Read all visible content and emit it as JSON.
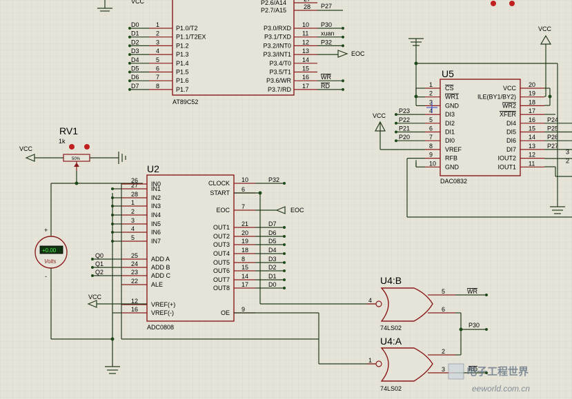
{
  "title": "",
  "components": {
    "at89c52": {
      "name": "AT89C52",
      "top_pins": [
        {
          "label": "P2.6/A14",
          "num": "27",
          "net": ""
        },
        {
          "label": "P2.7/A15",
          "num": "28",
          "net": "P27"
        }
      ],
      "left_pins": [
        {
          "net": "D0",
          "num": "1",
          "label": "P1.0/T2"
        },
        {
          "net": "D1",
          "num": "2",
          "label": "P1.1/T2EX"
        },
        {
          "net": "D2",
          "num": "3",
          "label": "P1.2"
        },
        {
          "net": "D3",
          "num": "4",
          "label": "P1.3"
        },
        {
          "net": "D4",
          "num": "5",
          "label": "P1.4"
        },
        {
          "net": "D5",
          "num": "6",
          "label": "P1.5"
        },
        {
          "net": "D6",
          "num": "7",
          "label": "P1.6"
        },
        {
          "net": "D7",
          "num": "8",
          "label": "P1.7"
        }
      ],
      "right_pins": [
        {
          "label": "P3.0/RXD",
          "num": "10",
          "net": "P30"
        },
        {
          "label": "P3.1/TXD",
          "num": "11",
          "net": "xuan"
        },
        {
          "label": "P3.2/INT0",
          "num": "12",
          "net": "P32"
        },
        {
          "label": "P3.3/INT1",
          "num": "13",
          "net": "EOC"
        },
        {
          "label": "P3.4/T0",
          "num": "14",
          "net": ""
        },
        {
          "label": "P3.5/T1",
          "num": "15",
          "net": ""
        },
        {
          "label": "P3.6/WR",
          "num": "16",
          "net": "WR"
        },
        {
          "label": "P3.7/RD",
          "num": "17",
          "net": "RD"
        }
      ]
    },
    "adc0808": {
      "ref": "U2",
      "name": "ADC0808",
      "left_pins": [
        {
          "net": "",
          "num": "26",
          "label": "IN0"
        },
        {
          "net": "",
          "num": "27",
          "label": "IN1"
        },
        {
          "net": "",
          "num": "28",
          "label": "IN2"
        },
        {
          "net": "",
          "num": "1",
          "label": "IN3"
        },
        {
          "net": "",
          "num": "2",
          "label": "IN4"
        },
        {
          "net": "",
          "num": "3",
          "label": "IN5"
        },
        {
          "net": "",
          "num": "4",
          "label": "IN6"
        },
        {
          "net": "",
          "num": "5",
          "label": "IN7"
        },
        {
          "net": "Q0",
          "num": "25",
          "label": "ADD A"
        },
        {
          "net": "Q1",
          "num": "24",
          "label": "ADD B"
        },
        {
          "net": "Q2",
          "num": "23",
          "label": "ADD C"
        },
        {
          "net": "",
          "num": "22",
          "label": "ALE"
        },
        {
          "net": "",
          "num": "12",
          "label": "VREF(+)"
        },
        {
          "net": "",
          "num": "16",
          "label": "VREF(-)"
        }
      ],
      "right_pins": [
        {
          "label": "CLOCK",
          "num": "10",
          "net": "P32"
        },
        {
          "label": "START",
          "num": "6",
          "net": ""
        },
        {
          "label": "EOC",
          "num": "7",
          "net": "EOC"
        },
        {
          "label": "OUT1",
          "num": "21",
          "net": "D7"
        },
        {
          "label": "OUT2",
          "num": "20",
          "net": "D6"
        },
        {
          "label": "OUT3",
          "num": "19",
          "net": "D5"
        },
        {
          "label": "OUT4",
          "num": "18",
          "net": "D4"
        },
        {
          "label": "OUT5",
          "num": "8",
          "net": "D3"
        },
        {
          "label": "OUT6",
          "num": "15",
          "net": "D2"
        },
        {
          "label": "OUT7",
          "num": "14",
          "net": "D1"
        },
        {
          "label": "OUT8",
          "num": "17",
          "net": "D0"
        },
        {
          "label": "OE",
          "num": "9",
          "net": ""
        }
      ]
    },
    "dac0832": {
      "ref": "U5",
      "name": "DAC0832",
      "left_pins": [
        {
          "net": "",
          "num": "1",
          "label": "CS"
        },
        {
          "net": "",
          "num": "2",
          "label": "WR1"
        },
        {
          "net": "",
          "num": "3",
          "label": "GND"
        },
        {
          "net": "P23",
          "num": "4",
          "label": "DI3"
        },
        {
          "net": "P22",
          "num": "5",
          "label": "DI2"
        },
        {
          "net": "P21",
          "num": "6",
          "label": "DI1"
        },
        {
          "net": "P20",
          "num": "7",
          "label": "DI0"
        },
        {
          "net": "",
          "num": "8",
          "label": "VREF"
        },
        {
          "net": "",
          "num": "9",
          "label": "RFB"
        },
        {
          "net": "",
          "num": "10",
          "label": "GND"
        }
      ],
      "right_pins": [
        {
          "label": "VCC",
          "num": "20",
          "net": ""
        },
        {
          "label": "ILE(BY1/BY2)",
          "num": "19",
          "net": ""
        },
        {
          "label": "WR2",
          "num": "18",
          "net": ""
        },
        {
          "label": "XFER",
          "num": "17",
          "net": ""
        },
        {
          "label": "DI4",
          "num": "16",
          "net": "P24"
        },
        {
          "label": "DI5",
          "num": "15",
          "net": "P25"
        },
        {
          "label": "DI6",
          "num": "14",
          "net": "P26"
        },
        {
          "label": "DI7",
          "num": "13",
          "net": "P27"
        },
        {
          "label": "IOUT2",
          "num": "12",
          "net": "3"
        },
        {
          "label": "IOUT1",
          "num": "11",
          "net": "2"
        }
      ]
    },
    "u4b": {
      "ref": "U4:B",
      "name": "74LS02",
      "in_a": "4",
      "in_b": "6",
      "out": "5",
      "out_net": "WR",
      "in_net": "P30"
    },
    "u4a": {
      "ref": "U4:A",
      "name": "74LS02",
      "in_a": "2",
      "in_b": "3",
      "out": "1",
      "in_net": "RD"
    },
    "rv1": {
      "ref": "RV1",
      "value": "1k",
      "percent": "50%"
    },
    "voltmeter": {
      "reading": "+0.00",
      "unit": "Volts",
      "plus": "+",
      "minus": "-"
    }
  },
  "labels": {
    "vcc": "VCC",
    "eoc": "EOC",
    "watermark_cn": "电子工程世界",
    "watermark_url": "eeworld.com.cn"
  }
}
